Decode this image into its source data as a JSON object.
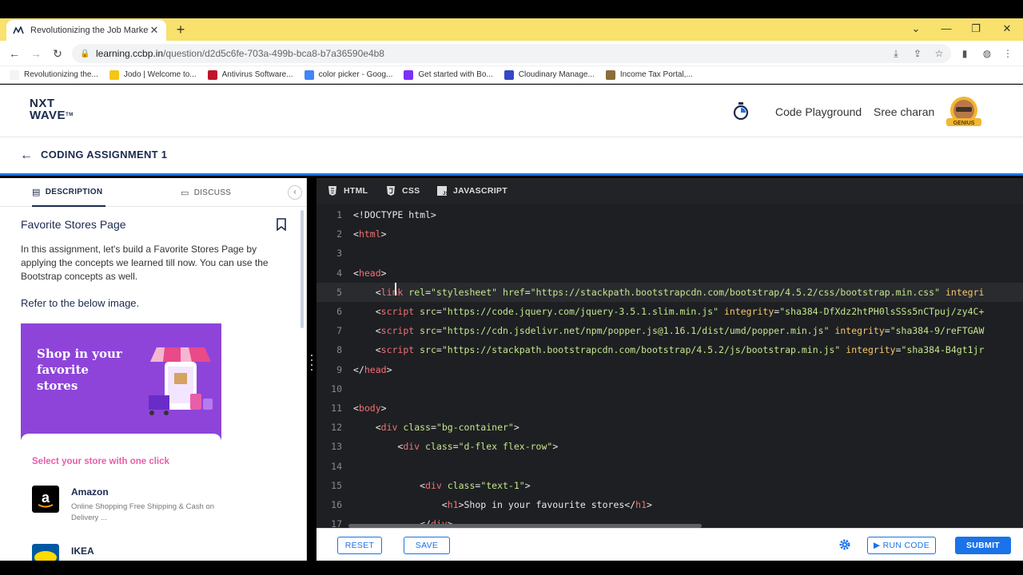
{
  "browser": {
    "tab_title": "Revolutionizing the Job Market |",
    "tab_close": "✕",
    "new_tab": "+",
    "url_host": "learning.ccbp.in",
    "url_path": "/question/d2d5c6fe-703a-499b-bca8-b7a36590e4b8",
    "bookmarks": [
      {
        "label": "Revolutionizing the...",
        "color": "#f4f4f4"
      },
      {
        "label": "Jodo | Welcome to...",
        "color": "#f5c518"
      },
      {
        "label": "Antivirus Software...",
        "color": "#c0162c"
      },
      {
        "label": "color picker - Goog...",
        "color": "#4285f4"
      },
      {
        "label": "Get started with Bo...",
        "color": "#7b2ff7"
      },
      {
        "label": "Cloudinary Manage...",
        "color": "#3448c5"
      },
      {
        "label": "Income Tax Portal,...",
        "color": "#8a6d3b"
      }
    ]
  },
  "header": {
    "logo_line1": "NXT",
    "logo_line2": "WAVE",
    "logo_tm": "TM",
    "code_playground": "Code Playground",
    "user_name": "Sree charan",
    "avatar_badge": "GENIUS"
  },
  "assignment": {
    "back_icon": "←",
    "title": "CODING ASSIGNMENT 1"
  },
  "left_panel": {
    "tabs": {
      "description": "DESCRIPTION",
      "discuss": "DISCUSS"
    },
    "collapse_icon": "‹",
    "title": "Favorite Stores Page",
    "description": "In this assignment, let's build a Favorite Stores Page by applying the concepts we learned till now. You can use the Bootstrap concepts as well.",
    "refer": "Refer to the below image.",
    "preview": {
      "heading": "Shop in your favorite stores"
    },
    "select_title": "Select your store with one click",
    "stores": [
      {
        "name": "Amazon",
        "desc": "Online Shopping Free Shipping & Cash on Delivery ..."
      },
      {
        "name": "IKEA",
        "desc": ""
      }
    ]
  },
  "editor": {
    "tabs": [
      "HTML",
      "CSS",
      "JAVASCRIPT"
    ],
    "lines": [
      {
        "n": "1",
        "indent": "",
        "parts": [
          [
            "tx",
            "<!DOCTYPE html>"
          ]
        ]
      },
      {
        "n": "2",
        "indent": "",
        "parts": [
          [
            "tx",
            "<"
          ],
          [
            "tg",
            "html"
          ],
          [
            "tx",
            ">"
          ]
        ]
      },
      {
        "n": "3",
        "indent": "",
        "parts": []
      },
      {
        "n": "4",
        "indent": "",
        "parts": [
          [
            "tx",
            "<"
          ],
          [
            "tg",
            "head"
          ],
          [
            "tx",
            ">"
          ]
        ]
      },
      {
        "n": "5",
        "indent": "    ",
        "parts": [
          [
            "tx",
            "<"
          ],
          [
            "tg",
            "link"
          ],
          [
            "tx",
            " "
          ],
          [
            "at",
            "rel"
          ],
          [
            "tx",
            "="
          ],
          [
            "st",
            "\"stylesheet\""
          ],
          [
            "tx",
            " "
          ],
          [
            "at",
            "href"
          ],
          [
            "tx",
            "="
          ],
          [
            "st",
            "\"https://stackpath.bootstrapcdn.com/bootstrap/4.5.2/css/bootstrap.min.css\""
          ],
          [
            "tx",
            " "
          ],
          [
            "at2",
            "integri"
          ]
        ]
      },
      {
        "n": "6",
        "indent": "    ",
        "parts": [
          [
            "tx",
            "<"
          ],
          [
            "tg",
            "script"
          ],
          [
            "tx",
            " "
          ],
          [
            "at",
            "src"
          ],
          [
            "tx",
            "="
          ],
          [
            "st",
            "\"https://code.jquery.com/jquery-3.5.1.slim.min.js\""
          ],
          [
            "tx",
            " "
          ],
          [
            "at2",
            "integrity"
          ],
          [
            "tx",
            "="
          ],
          [
            "st",
            "\"sha384-DfXdz2htPH0lsSSs5nCTpuj/zy4C+"
          ]
        ]
      },
      {
        "n": "7",
        "indent": "    ",
        "parts": [
          [
            "tx",
            "<"
          ],
          [
            "tg",
            "script"
          ],
          [
            "tx",
            " "
          ],
          [
            "at",
            "src"
          ],
          [
            "tx",
            "="
          ],
          [
            "st",
            "\"https://cdn.jsdelivr.net/npm/popper.js@1.16.1/dist/umd/popper.min.js\""
          ],
          [
            "tx",
            " "
          ],
          [
            "at2",
            "integrity"
          ],
          [
            "tx",
            "="
          ],
          [
            "st",
            "\"sha384-9/reFTGAW"
          ]
        ]
      },
      {
        "n": "8",
        "indent": "    ",
        "parts": [
          [
            "tx",
            "<"
          ],
          [
            "tg",
            "script"
          ],
          [
            "tx",
            " "
          ],
          [
            "at",
            "src"
          ],
          [
            "tx",
            "="
          ],
          [
            "st",
            "\"https://stackpath.bootstrapcdn.com/bootstrap/4.5.2/js/bootstrap.min.js\""
          ],
          [
            "tx",
            " "
          ],
          [
            "at2",
            "integrity"
          ],
          [
            "tx",
            "="
          ],
          [
            "st",
            "\"sha384-B4gt1jr"
          ]
        ]
      },
      {
        "n": "9",
        "indent": "",
        "parts": [
          [
            "tx",
            "</"
          ],
          [
            "tg",
            "head"
          ],
          [
            "tx",
            ">"
          ]
        ]
      },
      {
        "n": "10",
        "indent": "",
        "parts": []
      },
      {
        "n": "11",
        "indent": "",
        "parts": [
          [
            "tx",
            "<"
          ],
          [
            "tg",
            "body"
          ],
          [
            "tx",
            ">"
          ]
        ]
      },
      {
        "n": "12",
        "indent": "    ",
        "parts": [
          [
            "tx",
            "<"
          ],
          [
            "tg",
            "div"
          ],
          [
            "tx",
            " "
          ],
          [
            "at",
            "class"
          ],
          [
            "tx",
            "="
          ],
          [
            "st",
            "\"bg-container\""
          ],
          [
            "tx",
            ">"
          ]
        ]
      },
      {
        "n": "13",
        "indent": "        ",
        "parts": [
          [
            "tx",
            "<"
          ],
          [
            "tg",
            "div"
          ],
          [
            "tx",
            " "
          ],
          [
            "at",
            "class"
          ],
          [
            "tx",
            "="
          ],
          [
            "st",
            "\"d-flex flex-row\""
          ],
          [
            "tx",
            ">"
          ]
        ]
      },
      {
        "n": "14",
        "indent": "",
        "parts": []
      },
      {
        "n": "15",
        "indent": "            ",
        "parts": [
          [
            "tx",
            "<"
          ],
          [
            "tg",
            "div"
          ],
          [
            "tx",
            " "
          ],
          [
            "at",
            "class"
          ],
          [
            "tx",
            "="
          ],
          [
            "st",
            "\"text-1\""
          ],
          [
            "tx",
            ">"
          ]
        ]
      },
      {
        "n": "16",
        "indent": "                ",
        "parts": [
          [
            "tx",
            "<"
          ],
          [
            "tg",
            "h1"
          ],
          [
            "tx",
            ">Shop in your favourite stores</"
          ],
          [
            "tg",
            "h1"
          ],
          [
            "tx",
            ">"
          ]
        ]
      },
      {
        "n": "17",
        "indent": "            ",
        "parts": [
          [
            "tx",
            "</"
          ],
          [
            "tg",
            "div"
          ],
          [
            "tx",
            ">"
          ]
        ]
      }
    ]
  },
  "actions": {
    "reset": "RESET",
    "save": "SAVE",
    "run_code": "▶ RUN CODE",
    "submit": "SUBMIT"
  }
}
